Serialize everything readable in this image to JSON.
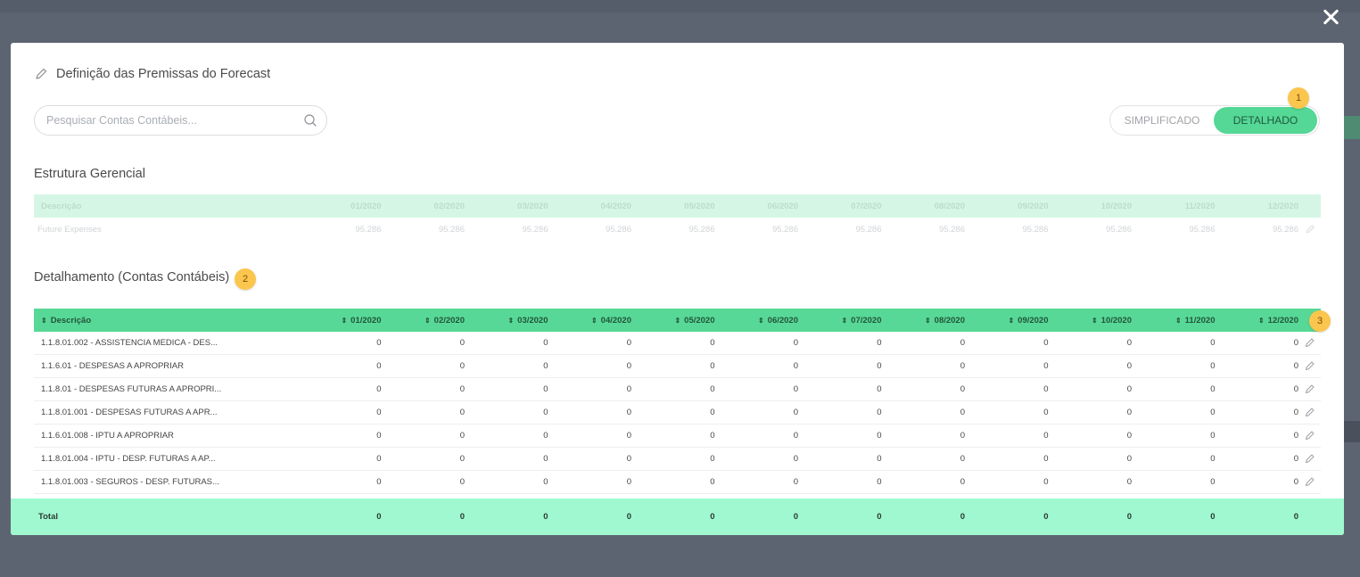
{
  "modal": {
    "title": "Definição das Premissas do Forecast",
    "search_placeholder": "Pesquisar Contas Contábeis...",
    "toggle": {
      "simplified": "SIMPLIFICADO",
      "detailed": "DETALHADO",
      "selected": "DETALHADO"
    },
    "badges": {
      "b1": "1",
      "b2": "2",
      "b3": "3"
    }
  },
  "gerencial": {
    "title": "Estrutura Gerencial",
    "header": [
      "Descrição",
      "01/2020",
      "02/2020",
      "03/2020",
      "04/2020",
      "05/2020",
      "06/2020",
      "07/2020",
      "08/2020",
      "09/2020",
      "10/2020",
      "11/2020",
      "12/2020"
    ],
    "row": [
      "Future Expenses",
      "95.286",
      "95.286",
      "95.286",
      "95.286",
      "95.286",
      "95.286",
      "95.286",
      "95.286",
      "95.286",
      "95.286",
      "95.286",
      "95.286"
    ]
  },
  "detalhamento": {
    "title": "Detalhamento (Contas Contábeis)",
    "header": [
      "Descrição",
      "01/2020",
      "02/2020",
      "03/2020",
      "04/2020",
      "05/2020",
      "06/2020",
      "07/2020",
      "08/2020",
      "09/2020",
      "10/2020",
      "11/2020",
      "12/2020"
    ],
    "rows": [
      [
        "1.1.8.01.002 - ASSISTENCIA MEDICA - DES...",
        "0",
        "0",
        "0",
        "0",
        "0",
        "0",
        "0",
        "0",
        "0",
        "0",
        "0",
        "0"
      ],
      [
        "1.1.6.01 - DESPESAS A APROPRIAR",
        "0",
        "0",
        "0",
        "0",
        "0",
        "0",
        "0",
        "0",
        "0",
        "0",
        "0",
        "0"
      ],
      [
        "1.1.8.01 - DESPESAS FUTURAS A APROPRI...",
        "0",
        "0",
        "0",
        "0",
        "0",
        "0",
        "0",
        "0",
        "0",
        "0",
        "0",
        "0"
      ],
      [
        "1.1.8.01.001 - DESPESAS FUTURAS A APR...",
        "0",
        "0",
        "0",
        "0",
        "0",
        "0",
        "0",
        "0",
        "0",
        "0",
        "0",
        "0"
      ],
      [
        "1.1.6.01.008 - IPTU A APROPRIAR",
        "0",
        "0",
        "0",
        "0",
        "0",
        "0",
        "0",
        "0",
        "0",
        "0",
        "0",
        "0"
      ],
      [
        "1.1.8.01.004 - IPTU - DESP. FUTURAS A AP...",
        "0",
        "0",
        "0",
        "0",
        "0",
        "0",
        "0",
        "0",
        "0",
        "0",
        "0",
        "0"
      ],
      [
        "1.1.8.01.003 - SEGUROS - DESP. FUTURAS...",
        "0",
        "0",
        "0",
        "0",
        "0",
        "0",
        "0",
        "0",
        "0",
        "0",
        "0",
        "0"
      ]
    ],
    "total": [
      "Total",
      "0",
      "0",
      "0",
      "0",
      "0",
      "0",
      "0",
      "0",
      "0",
      "0",
      "0",
      "0"
    ]
  },
  "icons": {
    "close": "close-icon",
    "edit": "pencil-icon",
    "search": "search-icon",
    "sort": "sort-icon"
  },
  "colors": {
    "accent": "#55d797",
    "total_bar": "#9ff8cf",
    "badge": "#fbc64e"
  }
}
